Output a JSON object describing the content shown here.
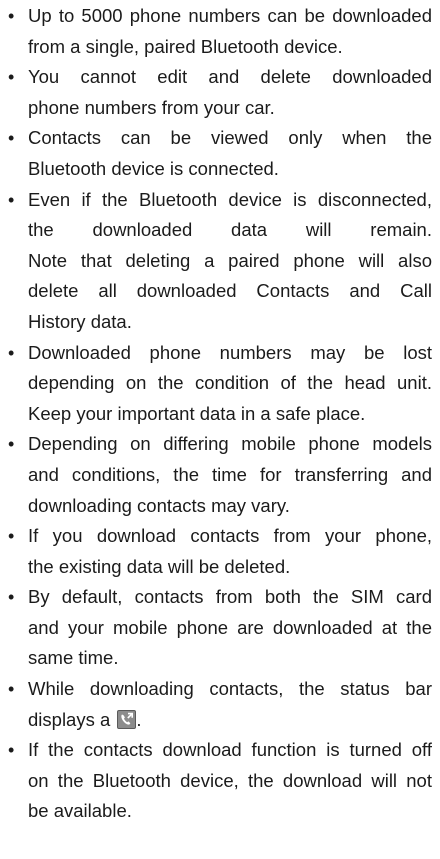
{
  "bullet_symbol": "•",
  "bullets": [
    {
      "lines": [
        "Up to 5000 phone numbers can be downloaded",
        "from a single, paired Bluetooth device."
      ]
    },
    {
      "lines": [
        "You cannot edit and delete downloaded",
        "phone numbers from your car."
      ]
    },
    {
      "lines": [
        "Contacts can be viewed only when the",
        "Bluetooth device is connected."
      ]
    },
    {
      "lines": [
        "Even if the Bluetooth device is disconnected,",
        "the downloaded data will remain.",
        "Note that deleting a paired phone will also",
        "delete all downloaded Contacts and Call",
        "History data."
      ]
    },
    {
      "lines": [
        "Downloaded phone numbers may be lost",
        "depending on the condition of the head unit.",
        "Keep your important data in a safe place."
      ]
    },
    {
      "lines": [
        "Depending on differing mobile phone models",
        "and conditions, the time for transferring and",
        "downloading contacts may vary."
      ]
    },
    {
      "lines": [
        "If you download contacts from your phone,",
        "the existing data will be deleted."
      ]
    },
    {
      "lines": [
        "By default, contacts from both the SIM card",
        "and your mobile phone are downloaded at the",
        "same time."
      ]
    },
    {
      "lines": [
        "While downloading contacts, the status bar",
        "displays a"
      ],
      "after_icon": ".",
      "icon": "contacts-download-icon"
    },
    {
      "lines": [
        "If the contacts download function is turned off",
        "on the Bluetooth device, the download will not",
        "be available."
      ]
    }
  ],
  "colors": {
    "text": "#1b1b1b",
    "icon_background": "#8c8c8c"
  }
}
